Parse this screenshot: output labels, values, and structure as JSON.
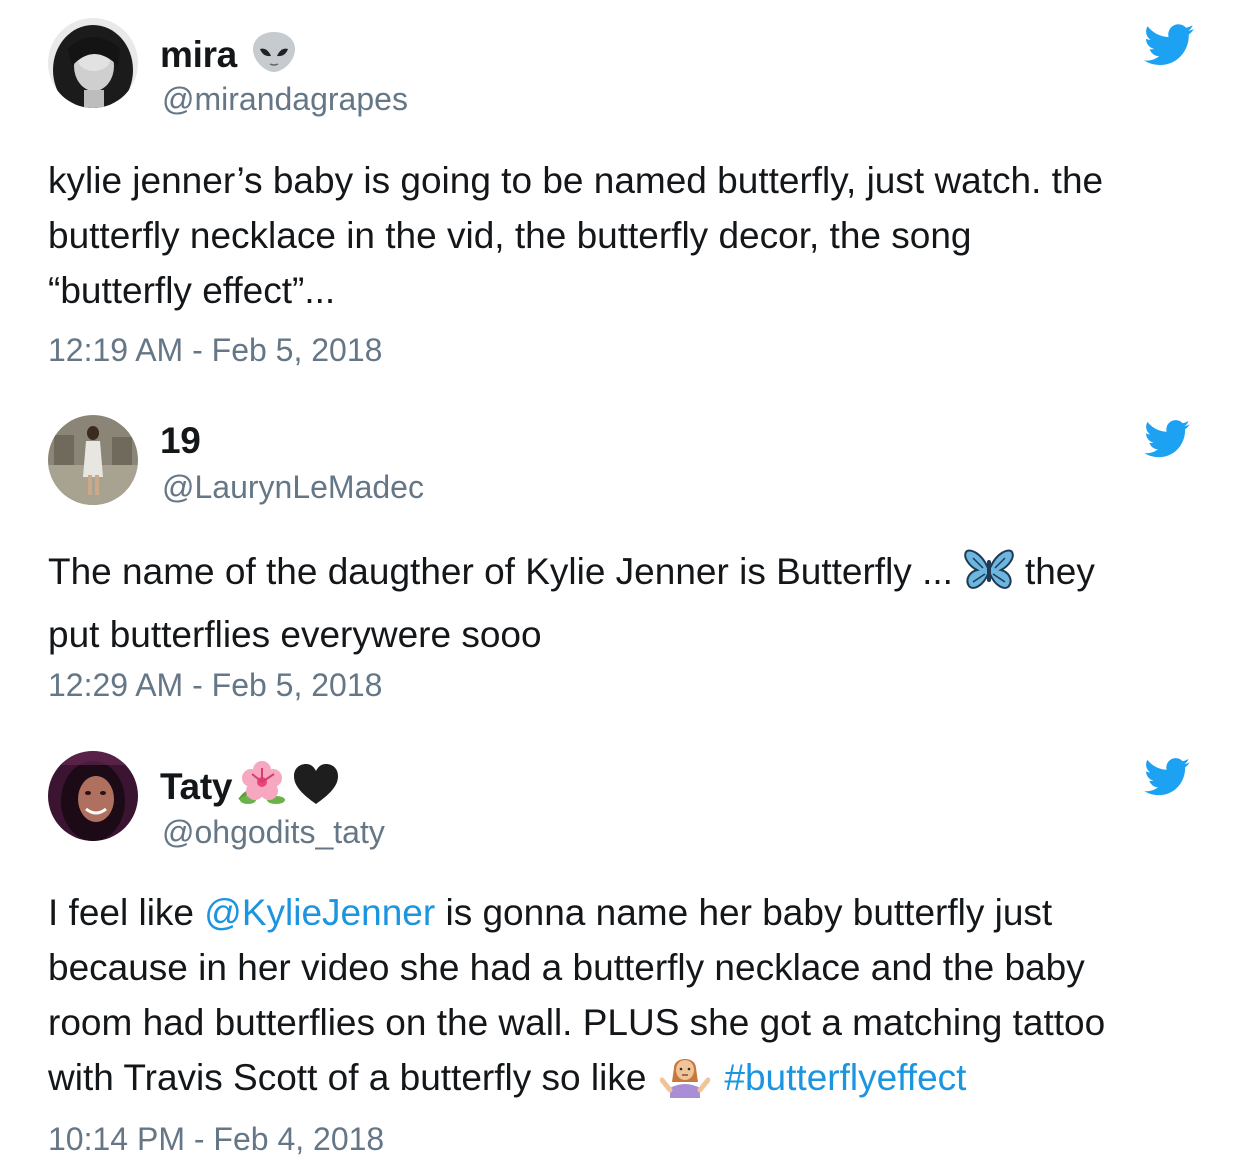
{
  "tweets": [
    {
      "display_name": "mira",
      "name_emoji": [
        "alien-icon"
      ],
      "handle": "@mirandagrapes",
      "lines": [
        "kylie jenner’s baby is going to be named butterfly, just watch. the",
        "butterfly necklace in the vid, the butterfly decor, the song",
        "“butterfly effect”..."
      ],
      "timestamp": "12:19 AM - Feb 5, 2018"
    },
    {
      "display_name": "19",
      "handle": "@LaurynLeMadec",
      "line1_before": "The name of the daugther of Kylie Jenner is Butterfly ...",
      "line1_emoji": "butterfly-icon",
      "line1_after": "they",
      "line2": "put butterflies everywere sooo",
      "timestamp": "12:29 AM - Feb 5, 2018"
    },
    {
      "display_name": "Taty",
      "name_emoji": [
        "hibiscus-icon",
        "black-heart-icon"
      ],
      "handle": "@ohgodits_taty",
      "line1_pre": "I feel like ",
      "mention": "@KylieJenner",
      "line1_post": " is gonna name her baby butterfly just",
      "line2": "because in her video she had a butterfly necklace and the baby",
      "line3": "room had butterflies on the wall. PLUS she got a matching tattoo",
      "line4_pre": "with Travis Scott of a butterfly so like",
      "line4_emoji": "shrug-icon",
      "hashtag": "#butterflyeffect",
      "timestamp": "10:14 PM - Feb 4, 2018"
    }
  ],
  "colors": {
    "text": "#14171a",
    "muted": "#657786",
    "link": "#1b95e0",
    "twitter": "#1da1f2"
  }
}
